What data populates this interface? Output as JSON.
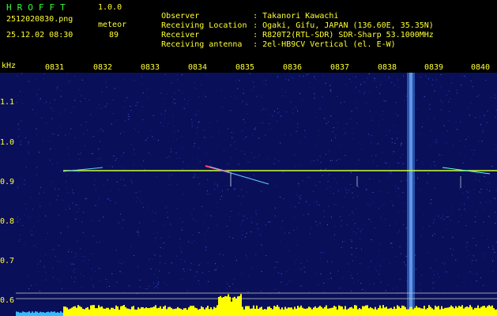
{
  "header": {
    "app_title": "HROFFT",
    "version": "1.0.0",
    "file_name": "2512020830.png",
    "meteor_label": "meteor",
    "datetime": "25.12.02 08:30",
    "meteor_count": "89"
  },
  "metadata": [
    {
      "key": "Observer",
      "value": "Takanori Kawachi"
    },
    {
      "key": "Receiving Location",
      "value": "Ogaki, Gifu, JAPAN (136.60E, 35.35N)"
    },
    {
      "key": "Receiver",
      "value": "R820T2(RTL-SDR) SDR-Sharp 53.1000MHz"
    },
    {
      "key": "Receiving antenna",
      "value": "2el-HB9CV Vertical (el. E-W)"
    }
  ],
  "axis": {
    "y_unit": "kHz",
    "y_ticks": [
      "1.1",
      "1.0",
      "0.9",
      "0.8",
      "0.7",
      "0.6"
    ],
    "x_ticks": [
      "0831",
      "0832",
      "0833",
      "0834",
      "0835",
      "0836",
      "0837",
      "0838",
      "0839",
      "0840"
    ]
  },
  "colors": {
    "background": "#0a0f5a",
    "carrier": "#ccff33",
    "text_yellow": "#ffff33",
    "text_green": "#33ff33",
    "spectrum": "#ffff00"
  }
}
